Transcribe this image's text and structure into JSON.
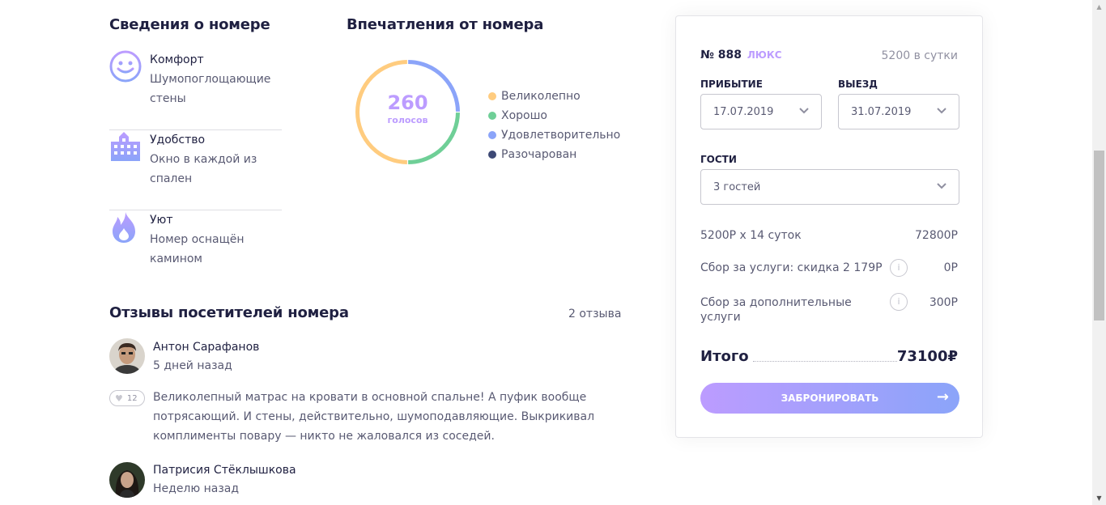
{
  "details": {
    "title": "Сведения о номере",
    "items": [
      {
        "icon": "smile-icon",
        "title": "Комфорт",
        "line1": "Шумопоглощающие",
        "line2": "стены"
      },
      {
        "icon": "building-icon",
        "title": "Удобство",
        "line1": "Окно в каждой из",
        "line2": "спален"
      },
      {
        "icon": "fire-icon",
        "title": "Уют",
        "line1": "Номер оснащён",
        "line2": "камином"
      }
    ]
  },
  "impressions": {
    "title": "Впечатления от номера",
    "votes": "260",
    "votes_label": "голосов",
    "legend": [
      {
        "label": "Великолепно",
        "color": "#ffcc7f"
      },
      {
        "label": "Хорошо",
        "color": "#6fcf97"
      },
      {
        "label": "Удовлетворительно",
        "color": "#8ba4f9"
      },
      {
        "label": "Разочарован",
        "color": "#3d4975"
      }
    ],
    "segments": [
      {
        "label": "Великолепно",
        "value": 130,
        "color": "#ffcc7f"
      },
      {
        "label": "Хорошо",
        "value": 65,
        "color": "#6fcf97"
      },
      {
        "label": "Удовлетворительно",
        "value": 65,
        "color": "#8ba4f9"
      },
      {
        "label": "Разочарован",
        "value": 0,
        "color": "#3d4975"
      }
    ]
  },
  "reviews": {
    "title": "Отзывы посетителей номера",
    "count": "2 отзыва",
    "items": [
      {
        "name": "Антон Сарафанов",
        "date": "5 дней назад",
        "likes": "12",
        "text": "Великолепный матрас на кровати в основной спальне! А пуфик вообще потрясающий. И стены, действительно, шумоподавляющие. Выкрикивал комплименты повару — никто не жаловался из соседей."
      },
      {
        "name": "Патрисия Стёклышкова",
        "date": "Неделю назад"
      }
    ]
  },
  "booking": {
    "room_prefix": "№ ",
    "room_number": "888",
    "room_type": "ЛЮКС",
    "price": "5200",
    "price_unit": "в сутки",
    "arrival_label": "ПРИБЫТИЕ",
    "arrival_value": "17.07.2019",
    "departure_label": "ВЫЕЗД",
    "departure_value": "31.07.2019",
    "guests_label": "ГОСТИ",
    "guests_value": "3 гостей",
    "calc_label": "5200Р х 14 суток",
    "calc_value": "72800Р",
    "service_label": "Сбор за услуги: скидка 2 179Р",
    "service_value": "0Р",
    "extra_label": "Сбор за дополнительные услуги",
    "extra_value": "300Р",
    "total_label": "Итого",
    "total_value": "73100₽",
    "book_button": "ЗАБРОНИРОВАТЬ"
  }
}
